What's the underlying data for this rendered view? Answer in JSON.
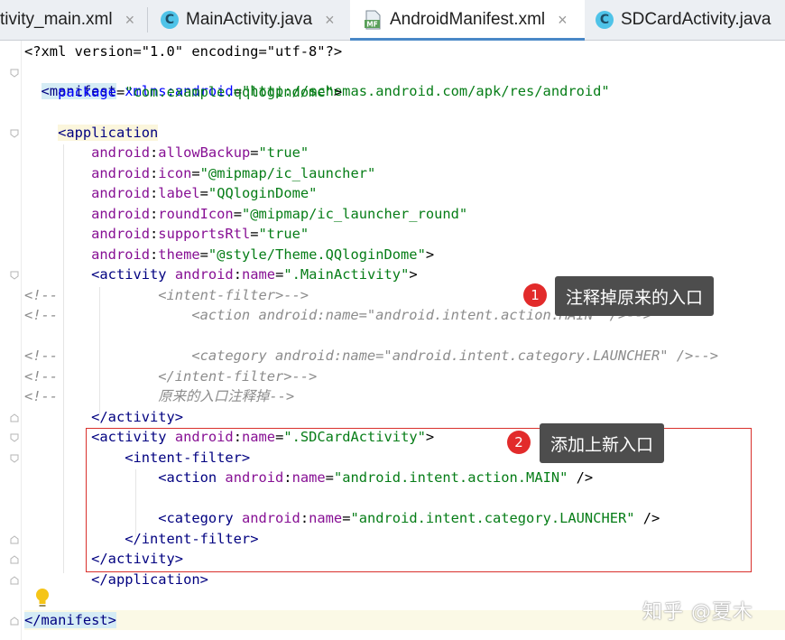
{
  "tabs": [
    {
      "label": "tivity_main.xml",
      "icon": "none",
      "active": false
    },
    {
      "label": "MainActivity.java",
      "icon": "c-class-icon",
      "active": false
    },
    {
      "label": "AndroidManifest.xml",
      "icon": "mf-file-icon",
      "active": true
    },
    {
      "label": "SDCardActivity.java",
      "icon": "c-class-icon",
      "active": false
    }
  ],
  "tab_close_glyph": "×",
  "tab_icon_letter": "C",
  "mf_icon_text": "MF",
  "code": [
    "<?xml version=\"1.0\" encoding=\"utf-8\"?>",
    "<manifest xmlns:android=\"http://schemas.android.com/apk/res/android\"",
    "    package=\"com.example.qqlogindome\">",
    "",
    "    <application",
    "        android:allowBackup=\"true\"",
    "        android:icon=\"@mipmap/ic_launcher\"",
    "        android:label=\"QQloginDome\"",
    "        android:roundIcon=\"@mipmap/ic_launcher_round\"",
    "        android:supportsRtl=\"true\"",
    "        android:theme=\"@style/Theme.QQloginDome\">",
    "        <activity android:name=\".MainActivity\">",
    "<!--            <intent-filter>-->",
    "<!--                <action android:name=\"android.intent.action.MAIN\" />-->",
    "",
    "<!--                <category android:name=\"android.intent.category.LAUNCHER\" />-->",
    "<!--            </intent-filter>-->",
    "<!--            原来的入口注释掉-->",
    "        </activity>",
    "        <activity android:name=\".SDCardActivity\">",
    "            <intent-filter>",
    "                <action android:name=\"android.intent.action.MAIN\" />",
    "",
    "                <category android:name=\"android.intent.category.LAUNCHER\" />",
    "            </intent-filter>",
    "        </activity>",
    "        </application>",
    "",
    "</manifest>"
  ],
  "annotations": [
    {
      "number": "1",
      "text": "注释掉原来的入口"
    },
    {
      "number": "2",
      "text": "添加上新入口"
    }
  ],
  "watermark": "知乎 @夏木",
  "colors": {
    "tag": "#000080",
    "attribute": "#0000ff",
    "namespace": "#871094",
    "value": "#067d17",
    "comment": "#8c8c8c",
    "highlight_box": "#d9302c",
    "annotation_bg": "#4d4d4d",
    "annotation_badge": "#e22b2b",
    "active_tab_underline": "#4a88c7"
  }
}
